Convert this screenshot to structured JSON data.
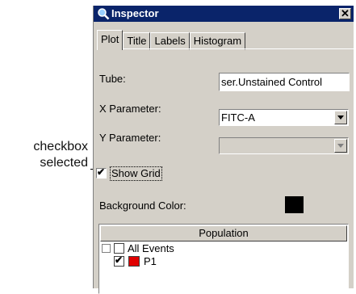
{
  "callout": {
    "line1": "checkbox",
    "line2": "selected"
  },
  "window": {
    "title": "Inspector",
    "close_glyph": "✕"
  },
  "tabs": [
    {
      "label": "Plot",
      "active": true
    },
    {
      "label": "Title",
      "active": false
    },
    {
      "label": "Labels",
      "active": false
    },
    {
      "label": "Histogram",
      "active": false
    }
  ],
  "form": {
    "tube_label": "Tube:",
    "tube_value": "ser.Unstained Control",
    "x_param_label": "X Parameter:",
    "x_param_value": "FITC-A",
    "y_param_label": "Y Parameter:",
    "y_param_value": "",
    "show_grid_label": "Show Grid",
    "show_grid_checked": true,
    "check_glyph": "✔",
    "bg_color_label": "Background Color:",
    "bg_color": "#000000"
  },
  "population": {
    "header": "Population",
    "items": [
      {
        "label": "All Events",
        "checked": false,
        "color": "#ffffff"
      },
      {
        "label": "P1",
        "checked": true,
        "color": "#e00000"
      }
    ]
  },
  "colors": {
    "titlebar": "#0a246a",
    "panel": "#d4d0c8"
  }
}
